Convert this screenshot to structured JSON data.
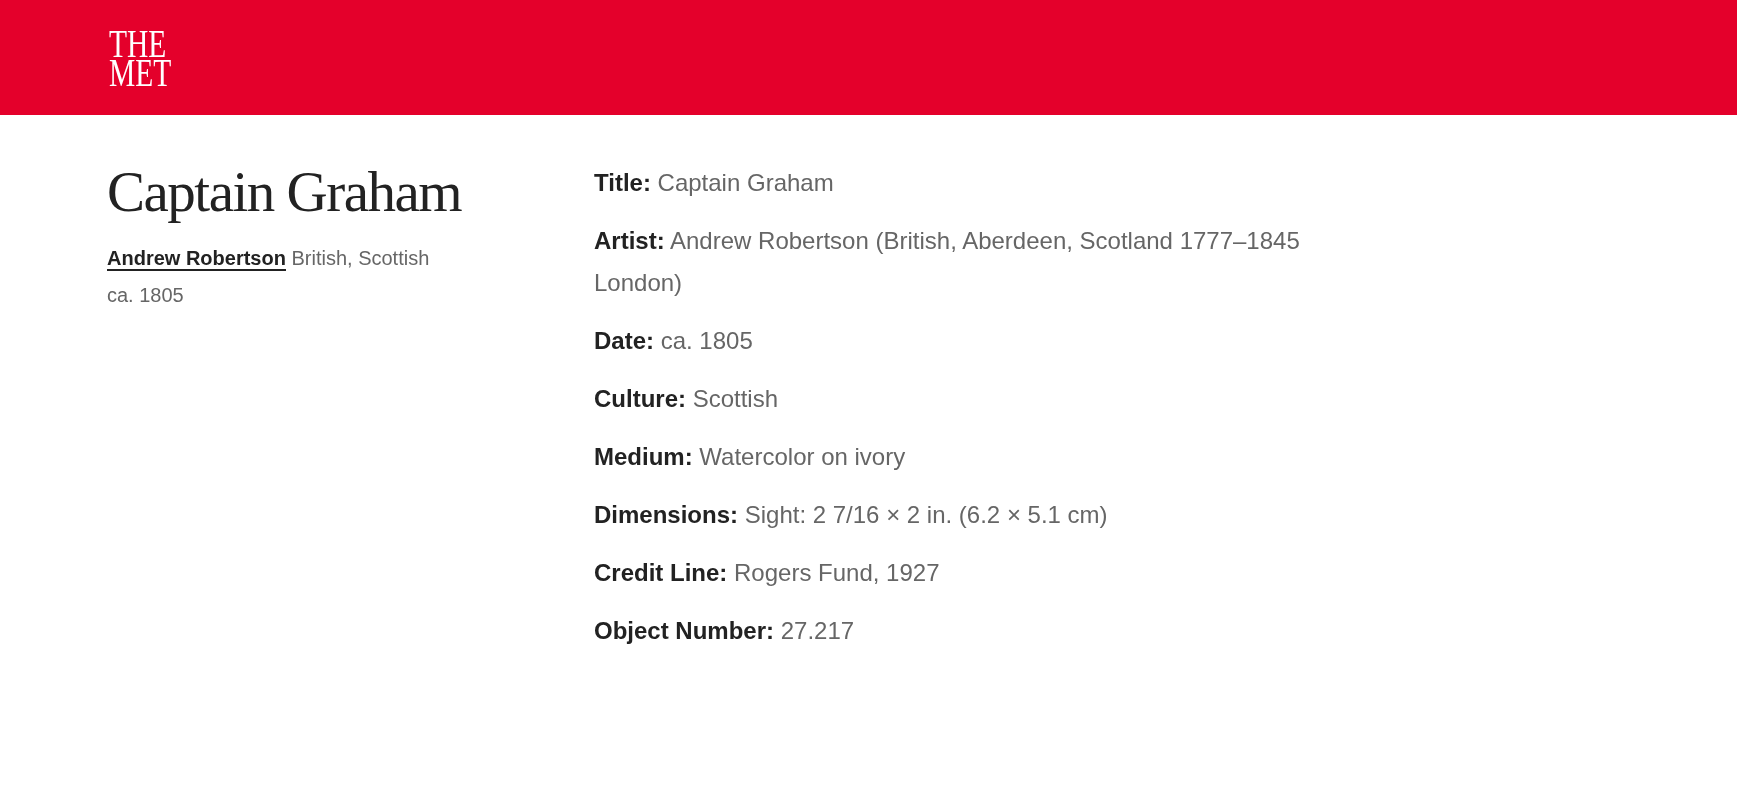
{
  "header": {
    "logo": [
      "THE",
      "MET"
    ]
  },
  "summary": {
    "title": "Captain Graham",
    "artist": {
      "name": "Andrew Robertson",
      "nationality": "British, Scottish"
    },
    "date": "ca. 1805"
  },
  "details": [
    {
      "label": "Title:",
      "value": "Captain Graham"
    },
    {
      "label": "Artist:",
      "value": "Andrew Robertson (British, Aberdeen, Scotland 1777–1845 London)"
    },
    {
      "label": "Date:",
      "value": "ca. 1805"
    },
    {
      "label": "Culture:",
      "value": "Scottish"
    },
    {
      "label": "Medium:",
      "value": "Watercolor on ivory"
    },
    {
      "label": "Dimensions:",
      "value": "Sight: 2 7/16 × 2 in. (6.2 × 5.1 cm)"
    },
    {
      "label": "Credit Line:",
      "value": "Rogers Fund, 1927"
    },
    {
      "label": "Object Number:",
      "value": "27.217"
    }
  ]
}
